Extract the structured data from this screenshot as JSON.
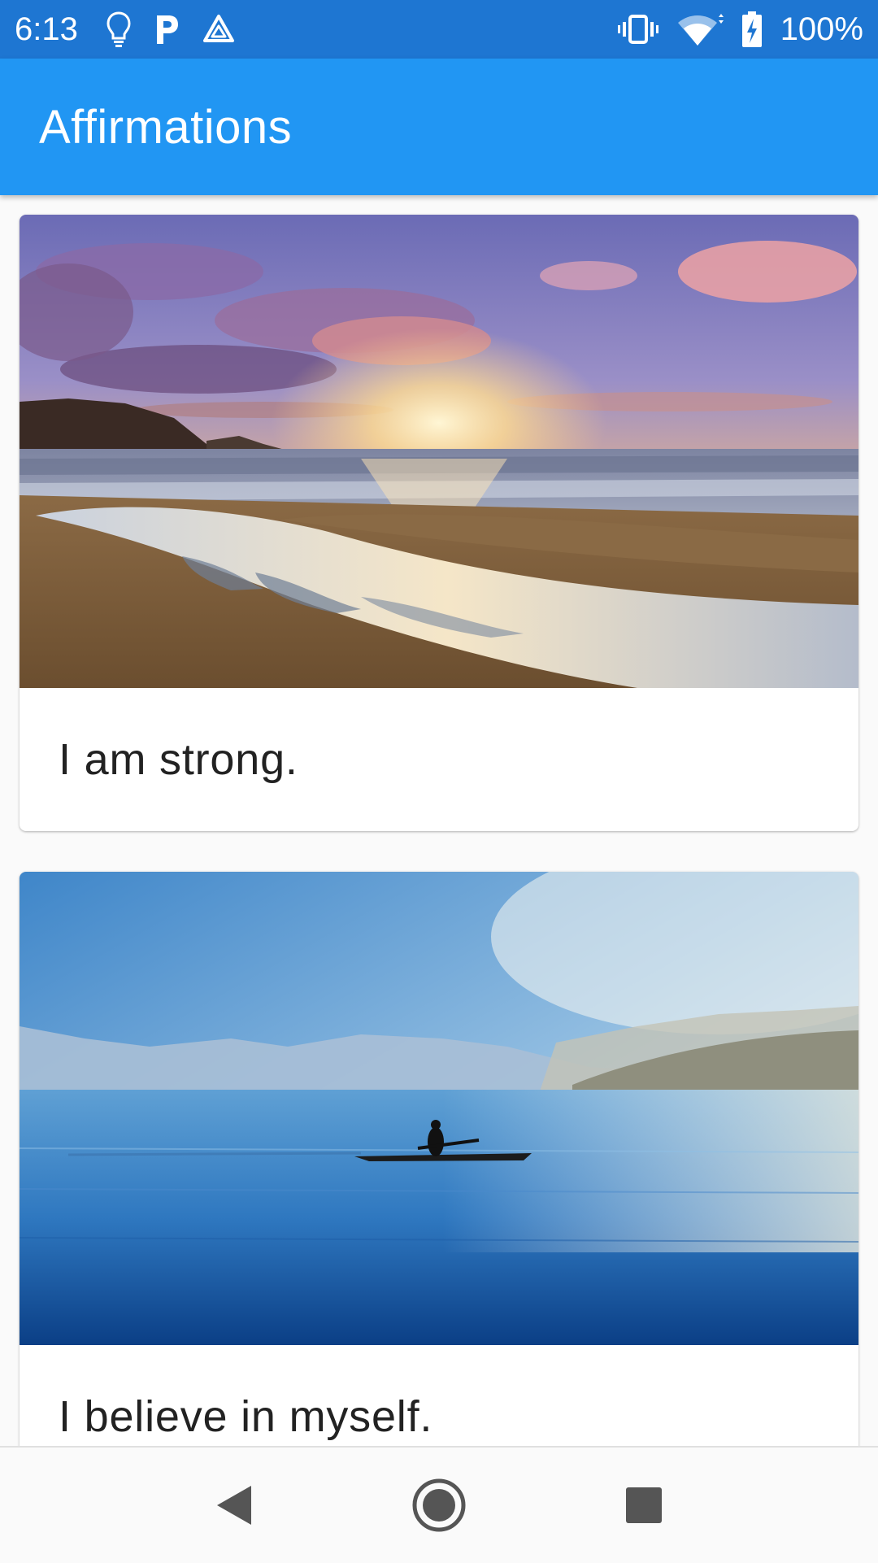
{
  "status_bar": {
    "time": "6:13",
    "battery_percent": "100%",
    "left_icons": [
      "lightbulb-icon",
      "p-icon",
      "triangle-icon"
    ],
    "right_icons": [
      "vibrate-icon",
      "wifi-icon",
      "battery-charging-icon"
    ]
  },
  "app_bar": {
    "title": "Affirmations"
  },
  "cards": [
    {
      "text": "I am strong.",
      "image": "beach-sunset-image"
    },
    {
      "text": "I believe in myself.",
      "image": "lake-kayak-image"
    }
  ],
  "nav_bar": {
    "buttons": [
      "back-icon",
      "home-icon",
      "recents-icon"
    ]
  },
  "colors": {
    "status_bar": "#1e76d2",
    "app_bar": "#2196f3",
    "background": "#fafafa",
    "card": "#ffffff",
    "text": "#222222"
  }
}
